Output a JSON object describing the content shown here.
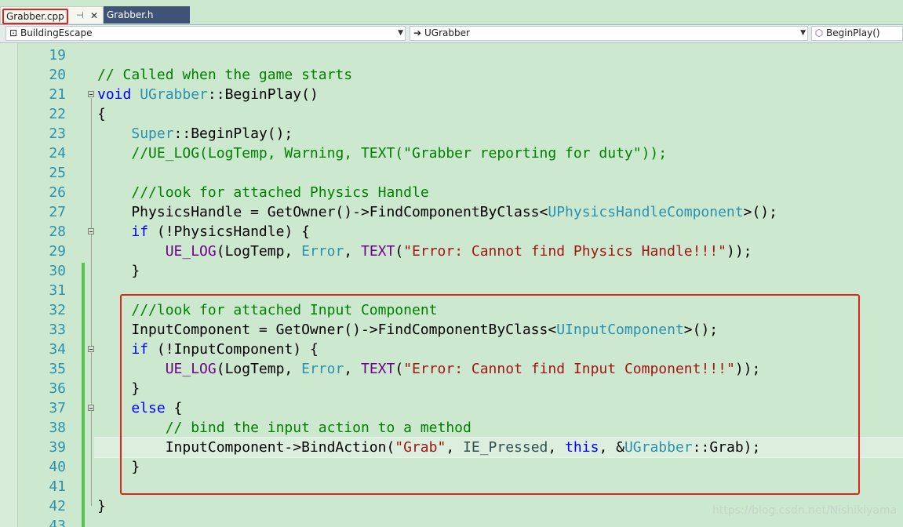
{
  "tabs": {
    "active": {
      "label": "Grabber.cpp",
      "pin_icon": "pin-icon",
      "close_icon": "close-icon"
    },
    "inactive": {
      "label": "Grabber.h"
    }
  },
  "navigation": {
    "project": "BuildingEscape",
    "class": "UGrabber",
    "member": "BeginPlay()"
  },
  "watermark": "https://blog.csdn.net/Nishikiyama",
  "editor": {
    "lines": [
      {
        "n": "19",
        "tokens": []
      },
      {
        "n": "20",
        "tokens": [
          {
            "t": "// Called when the game starts",
            "c": "com"
          }
        ]
      },
      {
        "n": "21",
        "tokens": [
          {
            "t": "void",
            "c": "kw"
          },
          {
            "t": " "
          },
          {
            "t": "UGrabber",
            "c": "type"
          },
          {
            "t": "::BeginPlay()"
          }
        ]
      },
      {
        "n": "22",
        "tokens": [
          {
            "t": "{"
          }
        ]
      },
      {
        "n": "23",
        "tokens": [
          {
            "t": "    "
          },
          {
            "t": "Super",
            "c": "type"
          },
          {
            "t": "::BeginPlay();"
          }
        ]
      },
      {
        "n": "24",
        "tokens": [
          {
            "t": "    "
          },
          {
            "t": "//UE_LOG(LogTemp, Warning, TEXT(\"Grabber reporting for duty\"));",
            "c": "com"
          }
        ]
      },
      {
        "n": "25",
        "tokens": []
      },
      {
        "n": "26",
        "tokens": [
          {
            "t": "    "
          },
          {
            "t": "///look for attached Physics Handle",
            "c": "com"
          }
        ]
      },
      {
        "n": "27",
        "tokens": [
          {
            "t": "    PhysicsHandle = GetOwner()->FindComponentByClass<"
          },
          {
            "t": "UPhysicsHandleComponent",
            "c": "type"
          },
          {
            "t": ">();"
          }
        ]
      },
      {
        "n": "28",
        "tokens": [
          {
            "t": "    "
          },
          {
            "t": "if",
            "c": "kw"
          },
          {
            "t": " (!PhysicsHandle) {"
          }
        ]
      },
      {
        "n": "29",
        "tokens": [
          {
            "t": "        "
          },
          {
            "t": "UE_LOG",
            "c": "mac"
          },
          {
            "t": "(LogTemp, "
          },
          {
            "t": "Error",
            "c": "type"
          },
          {
            "t": ", "
          },
          {
            "t": "TEXT",
            "c": "mac"
          },
          {
            "t": "("
          },
          {
            "t": "\"Error: Cannot find Physics Handle!!!\"",
            "c": "str"
          },
          {
            "t": "));"
          }
        ]
      },
      {
        "n": "30",
        "tokens": [
          {
            "t": "    }"
          }
        ]
      },
      {
        "n": "31",
        "tokens": []
      },
      {
        "n": "32",
        "tokens": [
          {
            "t": "    "
          },
          {
            "t": "///look for attached Input Component",
            "c": "com"
          }
        ]
      },
      {
        "n": "33",
        "tokens": [
          {
            "t": "    InputComponent = GetOwner()->FindComponentByClass<"
          },
          {
            "t": "UInputComponent",
            "c": "type"
          },
          {
            "t": ">();"
          }
        ]
      },
      {
        "n": "34",
        "tokens": [
          {
            "t": "    "
          },
          {
            "t": "if",
            "c": "kw"
          },
          {
            "t": " (!InputComponent) {"
          }
        ]
      },
      {
        "n": "35",
        "tokens": [
          {
            "t": "        "
          },
          {
            "t": "UE_LOG",
            "c": "mac"
          },
          {
            "t": "(LogTemp, "
          },
          {
            "t": "Error",
            "c": "type"
          },
          {
            "t": ", "
          },
          {
            "t": "TEXT",
            "c": "mac"
          },
          {
            "t": "("
          },
          {
            "t": "\"Error: Cannot find Input Component!!!\"",
            "c": "str"
          },
          {
            "t": "));"
          }
        ]
      },
      {
        "n": "36",
        "tokens": [
          {
            "t": "    }"
          }
        ]
      },
      {
        "n": "37",
        "tokens": [
          {
            "t": "    "
          },
          {
            "t": "else",
            "c": "kw"
          },
          {
            "t": " {"
          }
        ]
      },
      {
        "n": "38",
        "tokens": [
          {
            "t": "        "
          },
          {
            "t": "// bind the input action to a method",
            "c": "com"
          }
        ]
      },
      {
        "n": "39",
        "tokens": [
          {
            "t": "        InputComponent->BindAction("
          },
          {
            "t": "\"Grab\"",
            "c": "str"
          },
          {
            "t": ", "
          },
          {
            "t": "IE_Pressed",
            "c": "enum"
          },
          {
            "t": ", "
          },
          {
            "t": "this",
            "c": "kw"
          },
          {
            "t": ", &"
          },
          {
            "t": "UGrabber",
            "c": "type"
          },
          {
            "t": "::Grab);"
          }
        ]
      },
      {
        "n": "40",
        "tokens": [
          {
            "t": "    }"
          }
        ]
      },
      {
        "n": "41",
        "tokens": []
      },
      {
        "n": "42",
        "tokens": [
          {
            "t": "}"
          }
        ]
      },
      {
        "n": "43",
        "tokens": []
      }
    ]
  }
}
